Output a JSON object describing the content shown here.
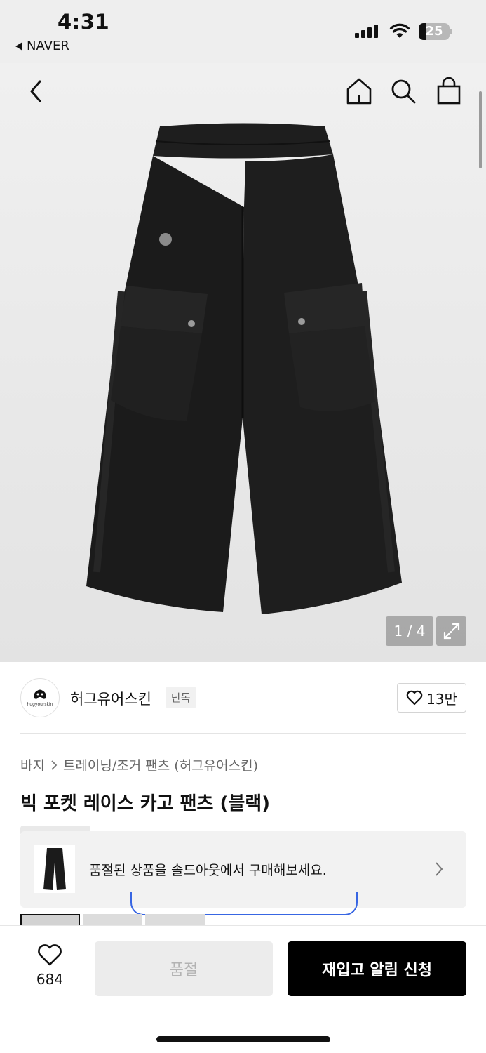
{
  "status_bar": {
    "time": "4:31",
    "back_app": "NAVER",
    "battery": "25",
    "battery_level": 0.25
  },
  "gallery": {
    "counter": "1 / 4"
  },
  "brand": {
    "name": "허그유어스킨",
    "badge": "단독",
    "likes": "13만"
  },
  "breadcrumb": {
    "category": "바지",
    "subcategory": "트레이닝/조거 팬츠 (허그유어스킨)"
  },
  "product": {
    "title": "빅 포켓 레이스 카고 팬츠 (블랙)"
  },
  "soldout_banner": {
    "text": "품절된 상품을 솔드아웃에서 구매해보세요."
  },
  "bottom_bar": {
    "wish_count": "684",
    "soldout_label": "품절",
    "restock_label": "재입고 알림 신청"
  }
}
